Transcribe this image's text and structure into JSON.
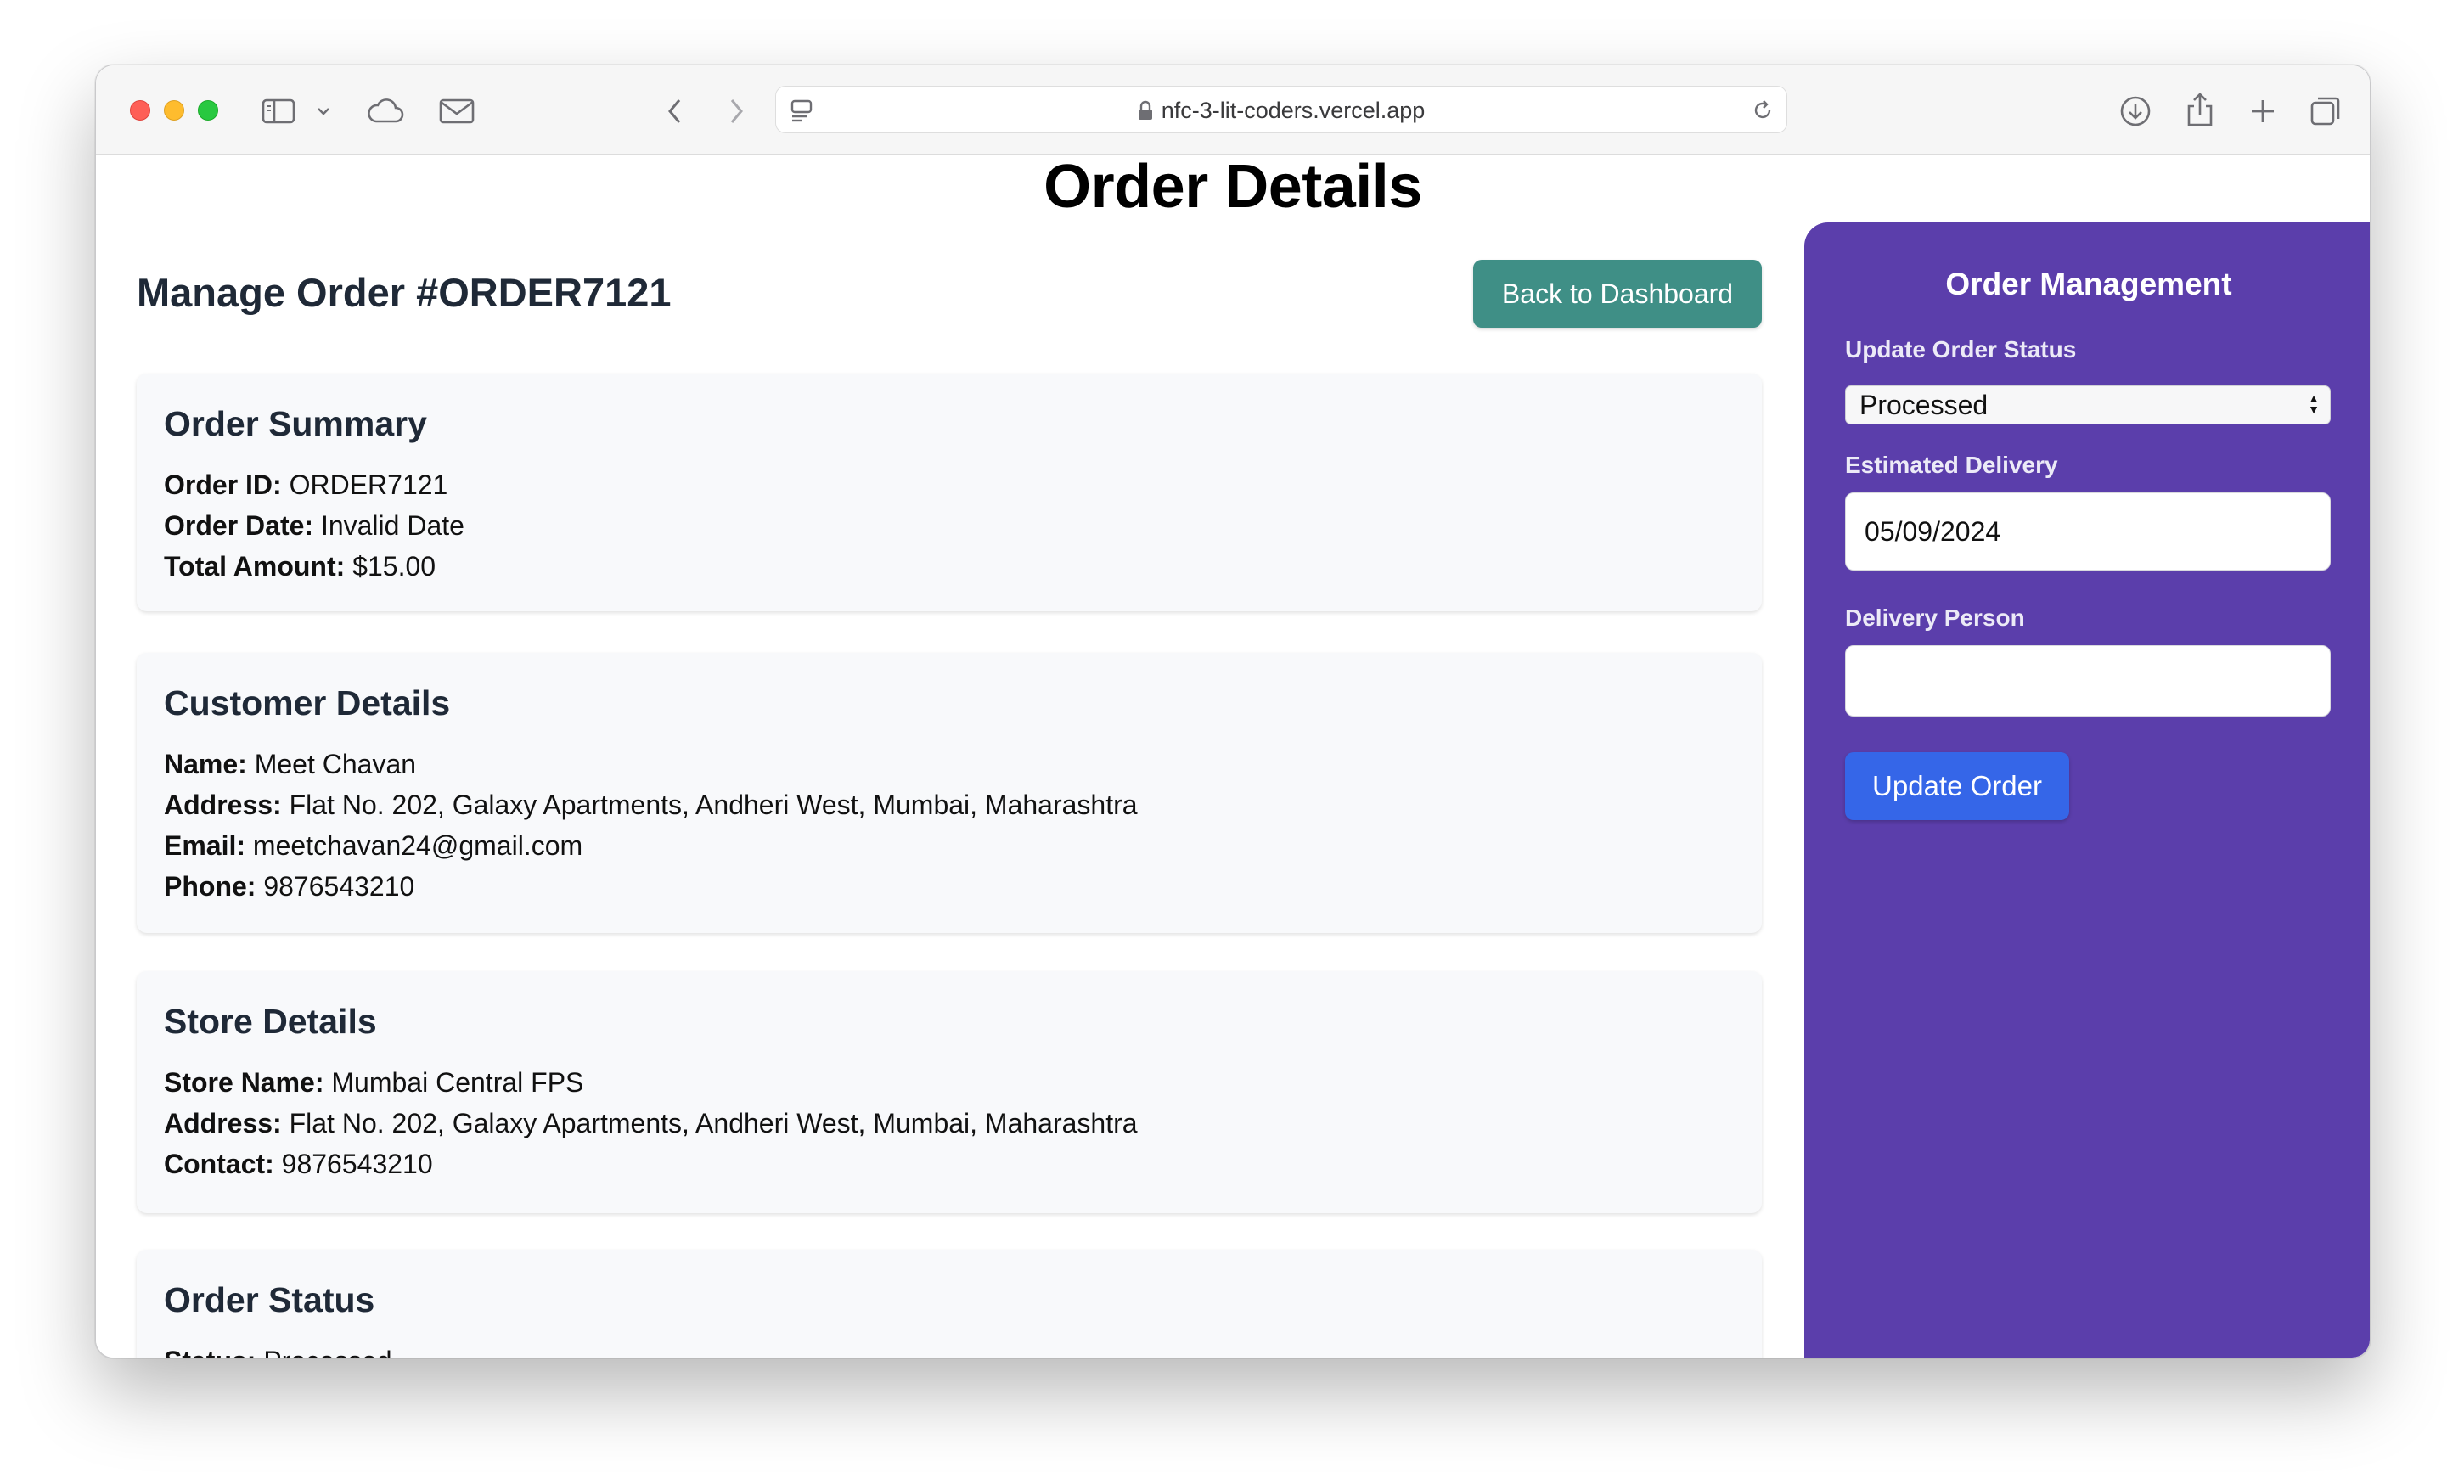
{
  "browser": {
    "url": "nfc-3-lit-coders.vercel.app"
  },
  "page": {
    "title": "Order Details",
    "manage_title": "Manage Order #ORDER7121",
    "back_button": "Back to Dashboard"
  },
  "order_summary": {
    "heading": "Order Summary",
    "rows": [
      {
        "label": "Order ID:",
        "value": "ORDER7121"
      },
      {
        "label": "Order Date:",
        "value": "Invalid Date"
      },
      {
        "label": "Total Amount:",
        "value": "$15.00"
      }
    ]
  },
  "customer_details": {
    "heading": "Customer Details",
    "rows": [
      {
        "label": "Name:",
        "value": "Meet Chavan"
      },
      {
        "label": "Address:",
        "value": "Flat No. 202, Galaxy Apartments, Andheri West, Mumbai, Maharashtra"
      },
      {
        "label": "Email:",
        "value": "meetchavan24@gmail.com"
      },
      {
        "label": "Phone:",
        "value": "9876543210"
      }
    ]
  },
  "store_details": {
    "heading": "Store Details",
    "rows": [
      {
        "label": "Store Name:",
        "value": "Mumbai Central FPS"
      },
      {
        "label": "Address:",
        "value": "Flat No. 202, Galaxy Apartments, Andheri West, Mumbai, Maharashtra"
      },
      {
        "label": "Contact:",
        "value": "9876543210"
      }
    ]
  },
  "order_status": {
    "heading": "Order Status",
    "rows": [
      {
        "label": "Status:",
        "value": "Processed"
      }
    ]
  },
  "sidebar": {
    "title": "Order Management",
    "status_label": "Update Order Status",
    "status_value": "Processed",
    "delivery_label": "Estimated Delivery",
    "delivery_value": "05/09/2024",
    "person_label": "Delivery Person",
    "person_value": "",
    "update_button": "Update Order"
  },
  "colors": {
    "sidebar_bg": "#5b3eab",
    "back_button_bg": "#3f8f86",
    "update_button_bg": "#3566e8"
  }
}
